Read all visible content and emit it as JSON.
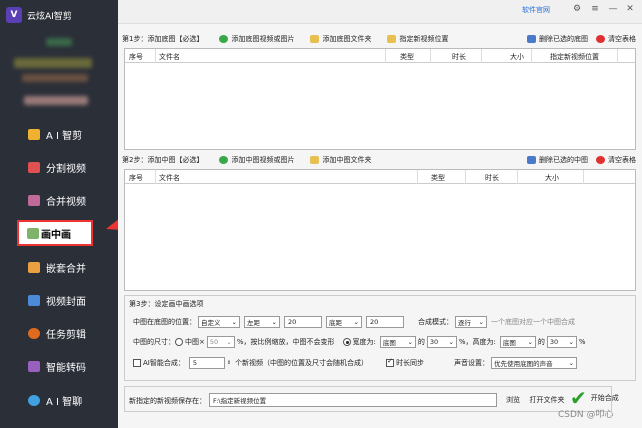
{
  "app": {
    "title": "云炫AI智剪",
    "logo_letter": "V"
  },
  "sidebar": {
    "items": [
      {
        "label": "A I 智剪",
        "icon": "ai-cut-icon",
        "color": "#f0b030"
      },
      {
        "label": "分割视频",
        "icon": "split-video-icon",
        "color": "#e05050"
      },
      {
        "label": "合并视频",
        "icon": "merge-video-icon",
        "color": "#c06a9a"
      },
      {
        "label": "画中画",
        "icon": "picture-in-picture-icon",
        "color": "#7fb36a"
      },
      {
        "label": "嵌套合并",
        "icon": "nested-merge-icon",
        "color": "#e8a040"
      },
      {
        "label": "视频封面",
        "icon": "video-cover-icon",
        "color": "#4a8ad8"
      },
      {
        "label": "任务剪辑",
        "icon": "task-edit-icon",
        "color": "#e06a20"
      },
      {
        "label": "智能转码",
        "icon": "smart-transcode-icon",
        "color": "#9a60c0"
      },
      {
        "label": "A I 智聊",
        "icon": "ai-chat-icon",
        "color": "#40a0e0"
      }
    ]
  },
  "topbar": {
    "link": "软件官网"
  },
  "step1": {
    "title": "第1步：添加底图【必选】",
    "add_files": "添加底图视频或图片",
    "add_folder": "添加底图文件夹",
    "set_location": "指定新视频位置",
    "delete_selected": "删除已选的底图",
    "clear": "清空表格",
    "columns": [
      "序号",
      "文件名",
      "类型",
      "时长",
      "大小",
      "指定新视频位置"
    ]
  },
  "step2": {
    "title": "第2步：添加中图【必选】",
    "add_files": "添加中图视频或图片",
    "add_folder": "添加中图文件夹",
    "delete_selected": "删除已选的中图",
    "clear": "清空表格",
    "columns": [
      "序号",
      "文件名",
      "类型",
      "时长",
      "大小"
    ]
  },
  "step3": {
    "title": "第3步：设定画中画选项",
    "position_label": "中图在底图的位置：",
    "position_mode": "自定义",
    "horizontal": "左距",
    "horizontal_value": "20",
    "vertical": "底距",
    "vertical_value": "20",
    "blend_label": "合成模式：",
    "blend_mode": "逐行",
    "blend_hint": "一个底图对应一个中图合成",
    "size_label": "中图的尺寸：",
    "size_opt1": "中图×",
    "size_percent": "50",
    "size_opt1_hint": "%，按比例缩放，中图不会变形",
    "width_label": "宽度为:",
    "width_ref": "底图",
    "of1": "的",
    "width_value": "30",
    "height_label": "%，高度为:",
    "height_ref": "底图",
    "of2": "的",
    "height_value": "30",
    "percent": "%",
    "ai_label": "AI智能合成：",
    "ai_count": "5",
    "ai_hint": "个新视频（中图的位置及尺寸会随机合成）",
    "sync_label": "时长同步",
    "audio_label": "声音设置：",
    "audio_value": "优先使用底图的声音"
  },
  "save": {
    "label": "新指定的新视频保存在：",
    "path": "F:\\指定新视频位置",
    "browse": "浏览",
    "open_folder": "打开文件夹",
    "start": "开始合成"
  },
  "watermark": "CSDN @叩心"
}
